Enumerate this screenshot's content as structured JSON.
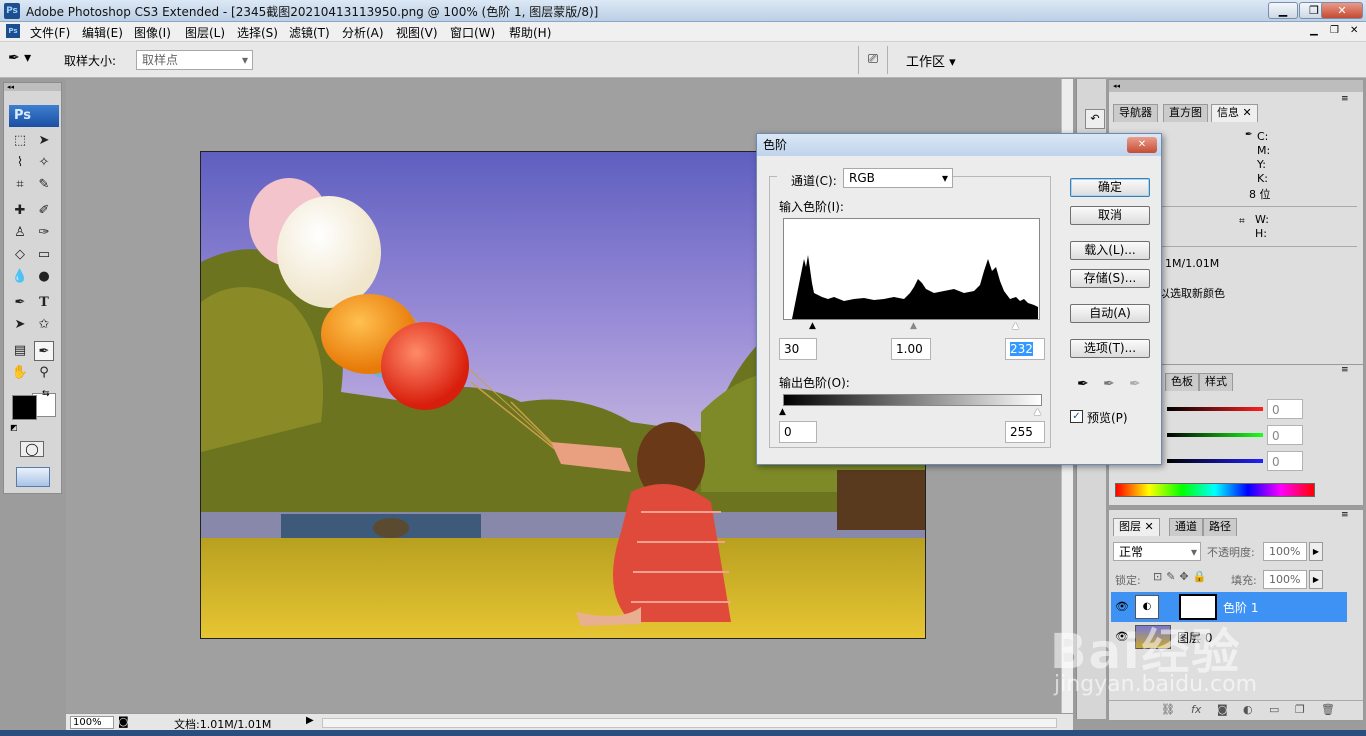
{
  "window": {
    "app_icon": "Ps",
    "title": "Adobe Photoshop CS3 Extended - [2345截图20210413113950.png @ 100% (色阶 1, 图层蒙版/8)]",
    "controls": [
      "minimize-icon",
      "restore-icon",
      "close-icon"
    ]
  },
  "menubar": {
    "doc_icon": "Ps",
    "items": [
      "文件(F)",
      "编辑(E)",
      "图像(I)",
      "图层(L)",
      "选择(S)",
      "滤镜(T)",
      "分析(A)",
      "视图(V)",
      "窗口(W)",
      "帮助(H)"
    ]
  },
  "options": {
    "tool_icon": "eyedropper-icon",
    "sample_size_label": "取样大小:",
    "sample_size_value": "取样点",
    "workspace_label": "工作区",
    "bridge_icon": "bridge-icon"
  },
  "toolbox": {
    "logo": "Ps",
    "tools": [
      "marquee",
      "move",
      "lasso",
      "magic-wand",
      "crop",
      "slice",
      "healing",
      "brush",
      "stamp",
      "history-brush",
      "eraser",
      "gradient",
      "blur",
      "dodge",
      "pen",
      "type",
      "path-select",
      "shape",
      "notes",
      "eyedropper",
      "hand",
      "zoom"
    ]
  },
  "status": {
    "zoom": "100%",
    "doc_info": "文档:1.01M/1.01M"
  },
  "info_panel": {
    "tabs": [
      "导航器",
      "直方图",
      "信息"
    ],
    "active_tab": "信息",
    "cmyk_labels": [
      "C:",
      "M:",
      "Y:",
      "K:"
    ],
    "bit_depth": "8 位",
    "wh_labels": [
      "W:",
      "H:"
    ],
    "doc_size": "1M/1.01M",
    "hint": "以选取新颜色"
  },
  "color_panel": {
    "tabs": [
      "色板",
      "样式"
    ],
    "values": [
      "0",
      "0",
      "0"
    ]
  },
  "layers_panel": {
    "tabs": [
      "图层",
      "通道",
      "路径"
    ],
    "blend_mode": "正常",
    "opacity_label": "不透明度:",
    "opacity_value": "100%",
    "lock_label": "锁定:",
    "fill_label": "填充:",
    "fill_value": "100%",
    "layers": [
      {
        "name": "色阶 1",
        "selected": true
      },
      {
        "name": "图层 0",
        "selected": false
      }
    ]
  },
  "levels_dialog": {
    "title": "色阶",
    "channel_label": "通道(C):",
    "channel_value": "RGB",
    "input_label": "输入色阶(I):",
    "input_values": [
      "30",
      "1.00",
      "232"
    ],
    "output_label": "输出色阶(O):",
    "output_values": [
      "0",
      "255"
    ],
    "buttons": {
      "ok": "确定",
      "cancel": "取消",
      "load": "载入(L)...",
      "save": "存储(S)...",
      "auto": "自动(A)",
      "options": "选项(T)..."
    },
    "preview_label": "预览(P)",
    "preview_checked": true
  },
  "watermark": {
    "brand": "Bai经验",
    "url": "jingyan.baidu.com"
  },
  "colors": {
    "accent": "#3399ff",
    "selected_layer": "#3d92f3",
    "dialog_border": "#6d8ab0"
  }
}
